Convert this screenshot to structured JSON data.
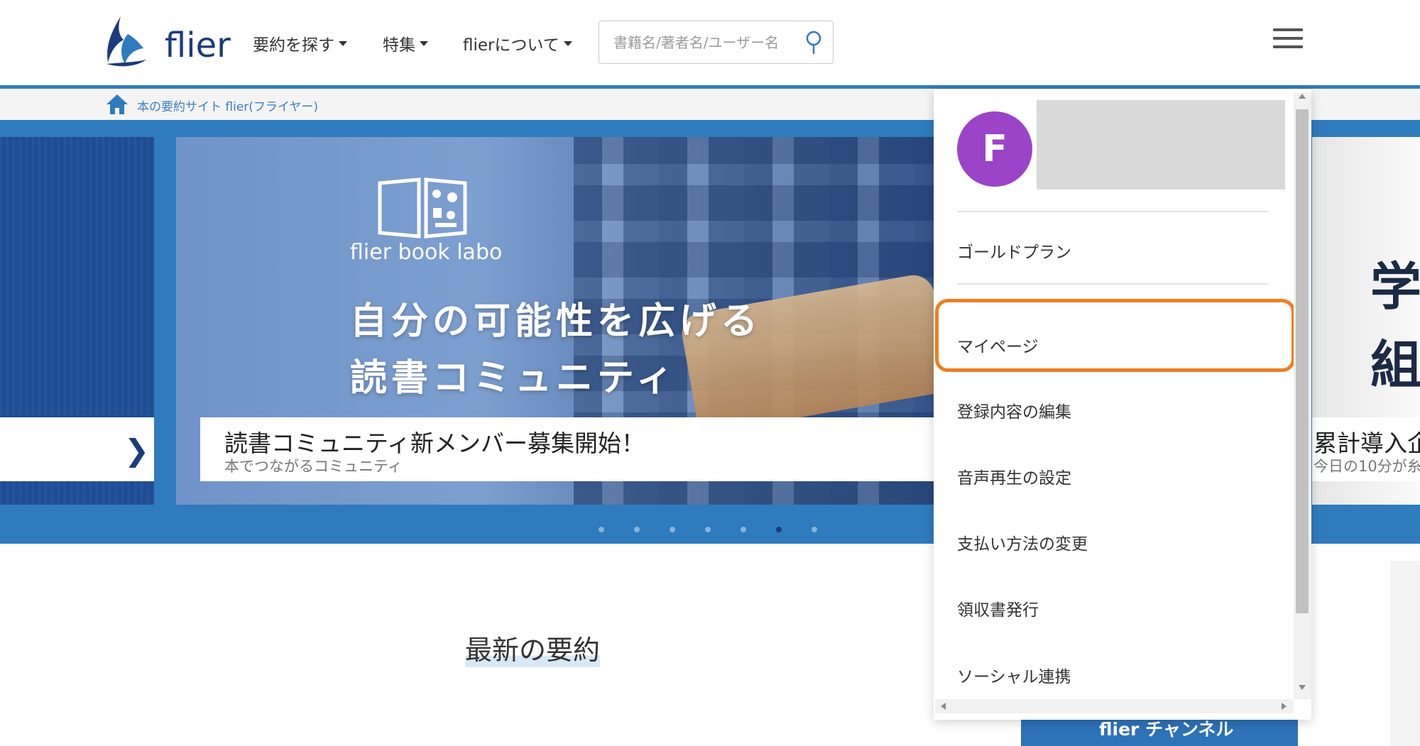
{
  "header": {
    "logo_text": "flier",
    "nav": [
      {
        "label": "要約を探す"
      },
      {
        "label": "特集"
      },
      {
        "label": "flierについて"
      }
    ],
    "search_placeholder": "書籍名/著者名/ユーザー名"
  },
  "breadcrumb": {
    "home_label": "本の要約サイト flier(フライヤー)"
  },
  "carousel": {
    "main_slide": {
      "brand": "flier book labo",
      "headline_line1": "自分の可能性を広げる",
      "headline_line2": "読書コミュニティ",
      "caption_title": "読書コミュニティ新メンバー募集開始！",
      "caption_subtitle": "本でつながるコミュニティ"
    },
    "right_slide": {
      "kanji1": "学",
      "kanji2": "組",
      "caption_title": "累計導入企",
      "caption_subtitle": "今日の10分が糸"
    },
    "dot_count": 7,
    "active_dot": 5
  },
  "main": {
    "section_title": "最新の要約",
    "channel_banner": "flier チャンネル"
  },
  "dropdown": {
    "avatar_letter": "F",
    "items": [
      {
        "label": "ゴールドプラン"
      },
      {
        "label": "マイページ"
      },
      {
        "label": "登録内容の編集"
      },
      {
        "label": "音声再生の設定"
      },
      {
        "label": "支払い方法の変更"
      },
      {
        "label": "領収書発行"
      },
      {
        "label": "ソーシャル連携"
      }
    ],
    "highlight_color": "#ef7d22",
    "avatar_color": "#9b44c8"
  },
  "colors": {
    "brand_blue": "#2f7bbd",
    "brand_navy": "#1b3c7c",
    "link_blue": "#3a7fc4"
  }
}
